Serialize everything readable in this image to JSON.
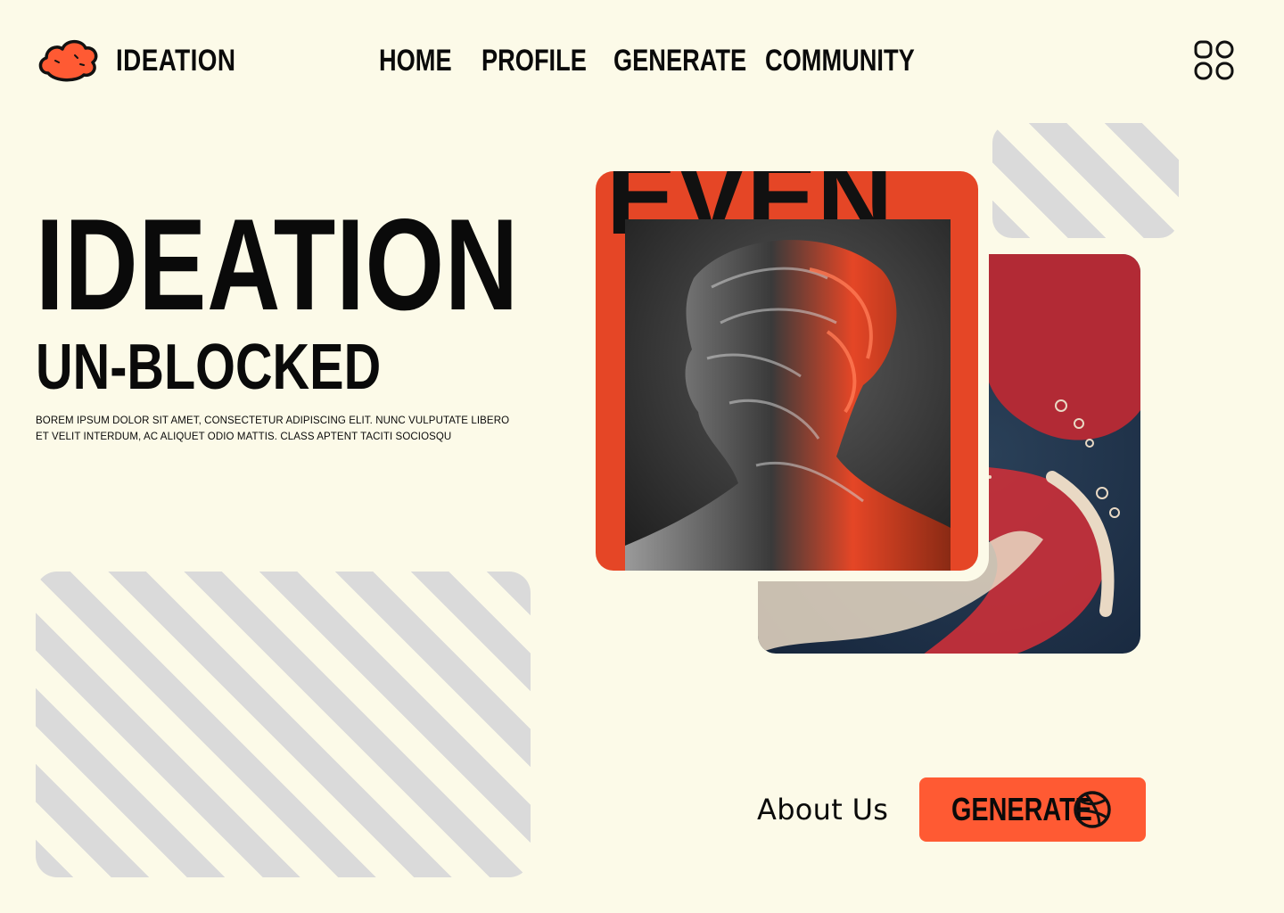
{
  "brand": {
    "name": "IDEATION",
    "logo_icon": "cloud-logo-icon",
    "accent": "#FF5A33"
  },
  "nav": {
    "items": [
      {
        "label": "HOME"
      },
      {
        "label": "PROFILE"
      },
      {
        "label": "GENERATE"
      },
      {
        "label": "COMMUNITY"
      }
    ],
    "menu_icon": "apps-grid-icon"
  },
  "hero": {
    "title": "IDEATION",
    "subtitle": "UN-BLOCKED",
    "description": "BOREM IPSUM DOLOR SIT AMET, CONSECTETUR ADIPISCING ELIT. NUNC VULPUTATE LIBERO ET VELIT INTERDUM, AC ALIQUET ODIO MATTIS. CLASS APTENT TACITI SOCIOSQU"
  },
  "artwork": {
    "front_overlay_text": "EVEN",
    "front_bg": "#E54626",
    "back_palette": [
      "#1E3148",
      "#C8303A",
      "#E9D9C4"
    ]
  },
  "actions": {
    "about_label": "About Us",
    "generate_label": "GENERATE",
    "generate_icon": "dribbble-icon",
    "button_color": "#FF5A33"
  },
  "colors": {
    "background": "#FCFAE8",
    "stripe": "#DADADA",
    "text": "#0A0A0A"
  }
}
